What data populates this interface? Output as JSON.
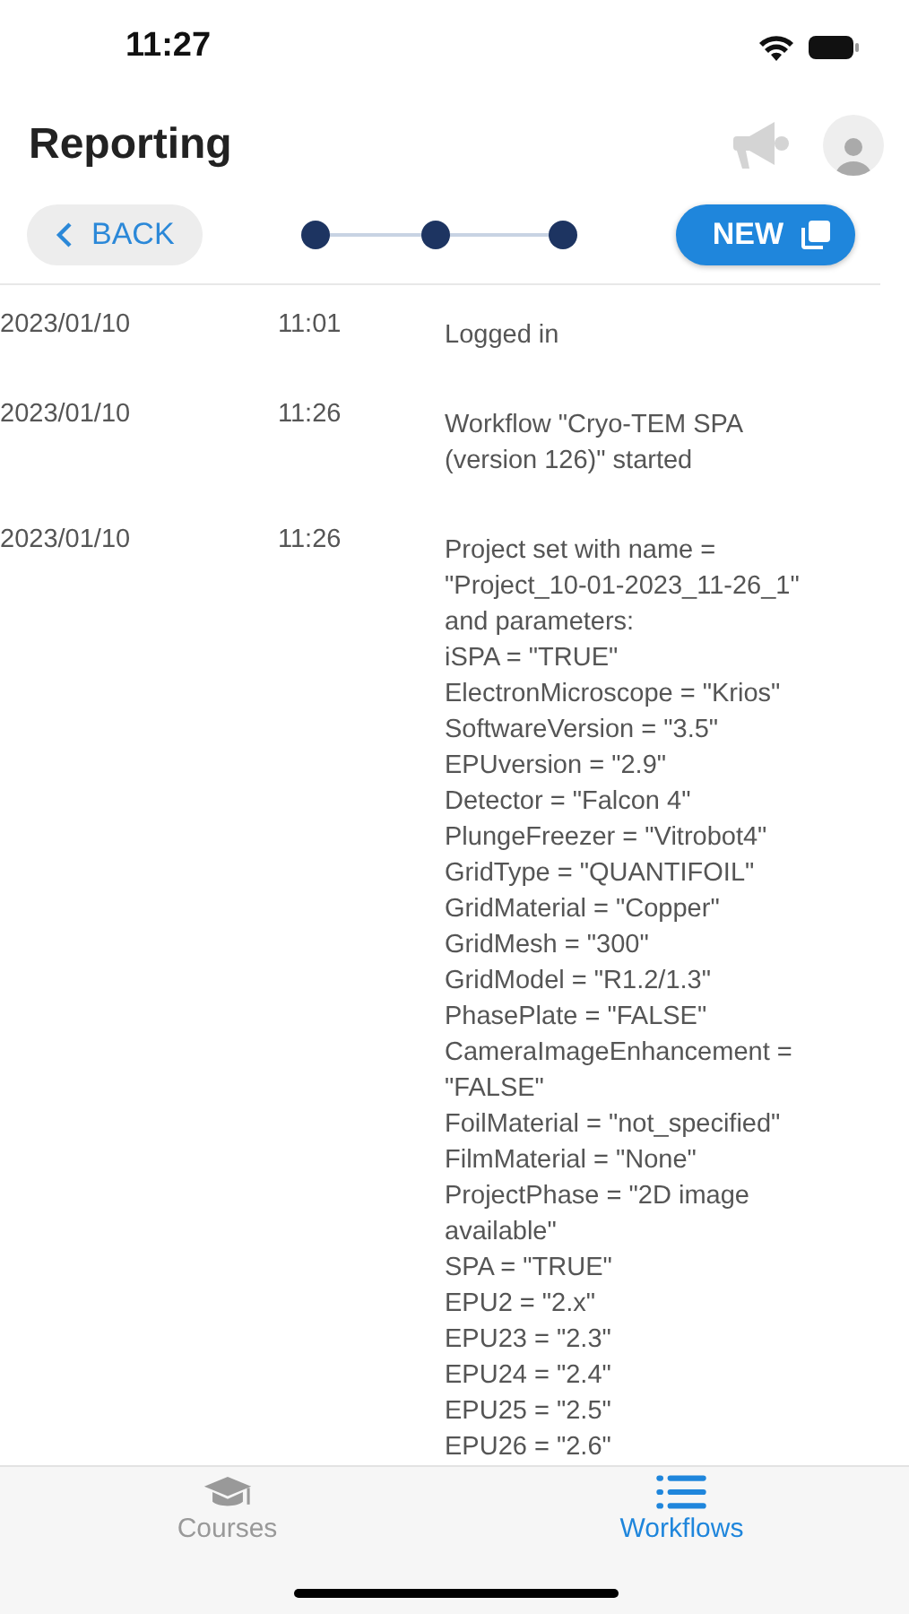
{
  "status_bar": {
    "time": "11:27"
  },
  "header": {
    "title": "Reporting"
  },
  "toolbar": {
    "back_label": "BACK",
    "new_label": "NEW"
  },
  "log": [
    {
      "date": "2023/01/10",
      "time": "11:01",
      "message": "Logged in"
    },
    {
      "date": "2023/01/10",
      "time": "11:26",
      "message": "Workflow \"Cryo-TEM SPA\n(version 126)\" started"
    },
    {
      "date": "2023/01/10",
      "time": "11:26",
      "message": "Project set with name =\n\"Project_10-01-2023_11-26_1\"\nand parameters:\niSPA = \"TRUE\"\nElectronMicroscope = \"Krios\"\nSoftwareVersion = \"3.5\"\nEPUversion = \"2.9\"\nDetector = \"Falcon 4\"\nPlungeFreezer = \"Vitrobot4\"\nGridType = \"QUANTIFOIL\"\nGridMaterial = \"Copper\"\nGridMesh = \"300\"\nGridModel = \"R1.2/1.3\"\nPhasePlate = \"FALSE\"\nCameraImageEnhancement =\n\"FALSE\"\nFoilMaterial = \"not_specified\"\nFilmMaterial = \"None\"\nProjectPhase = \"2D image\navailable\"\nSPA = \"TRUE\"\nEPU2 = \"2.x\"\nEPU23 = \"2.3\"\nEPU24 = \"2.4\"\nEPU25 = \"2.5\"\nEPU26 = \"2.6\""
    }
  ],
  "tab_bar": [
    {
      "kind": "courses",
      "label": "Courses",
      "selected": false
    },
    {
      "kind": "workflows",
      "label": "Workflows",
      "selected": true
    }
  ]
}
